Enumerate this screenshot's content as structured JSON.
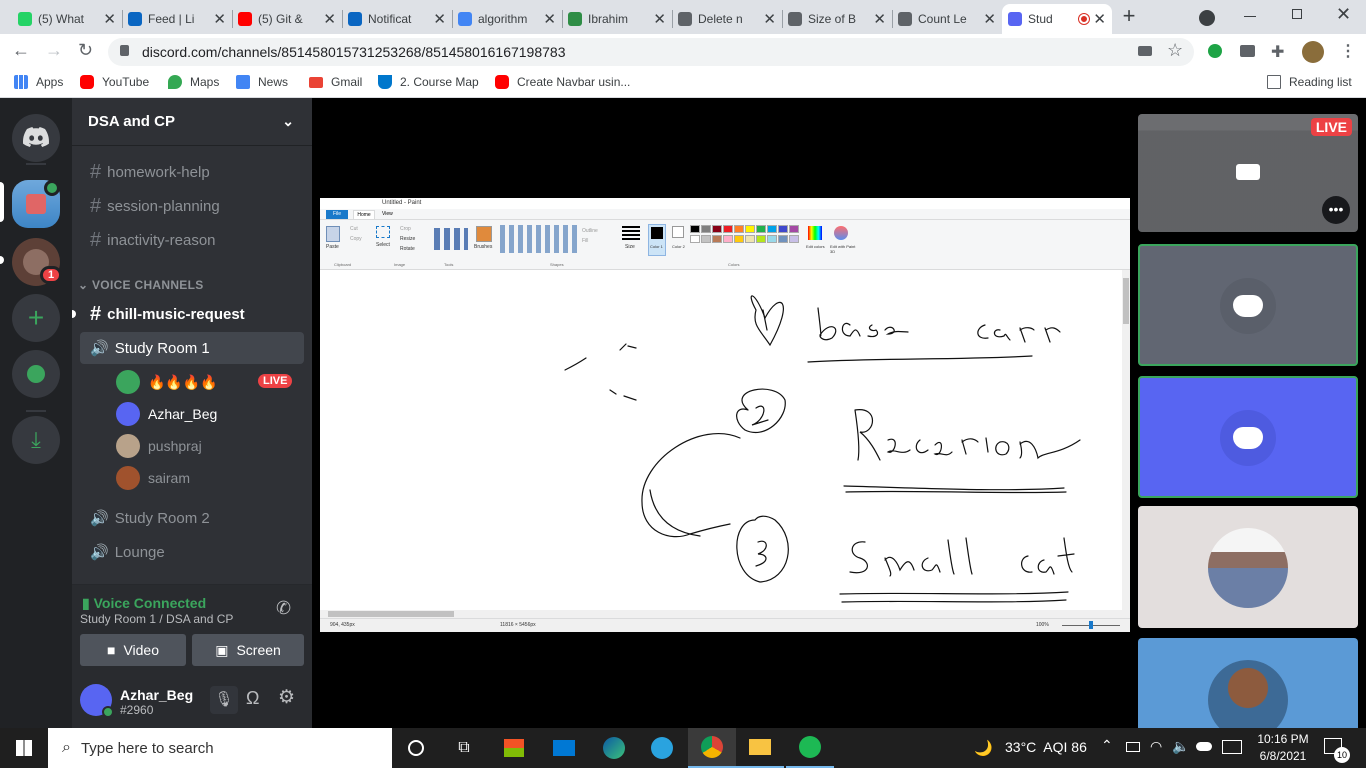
{
  "browser": {
    "tabs": [
      {
        "label": "(5) What",
        "fav": "whatsapp-icon",
        "color": "#25d366"
      },
      {
        "label": "Feed | Li",
        "fav": "linkedin-icon",
        "color": "#0a66c2"
      },
      {
        "label": "(5) Git &",
        "fav": "youtube-icon",
        "color": "#ff0000"
      },
      {
        "label": "Notificat",
        "fav": "linkedin-icon",
        "color": "#0a66c2"
      },
      {
        "label": "algorithm",
        "fav": "google-icon",
        "color": "#4285f4"
      },
      {
        "label": "Ibrahim",
        "fav": "gfg-icon",
        "color": "#2f8d46"
      },
      {
        "label": "Delete n",
        "fav": "globe-icon",
        "color": "#5f6368"
      },
      {
        "label": "Size of B",
        "fav": "globe-icon",
        "color": "#5f6368"
      },
      {
        "label": "Count Le",
        "fav": "globe-icon",
        "color": "#5f6368"
      },
      {
        "label": "Stud",
        "fav": "discord-icon",
        "color": "#5865f2"
      }
    ],
    "url": "discord.com/channels/851458015731253268/851458016167198783",
    "bookmarks": [
      "Apps",
      "YouTube",
      "Maps",
      "News",
      "Gmail",
      "2. Course Map",
      "Create Navbar usin..."
    ],
    "reading_list": "Reading list"
  },
  "discord": {
    "server_name": "DSA and CP",
    "text_channels": [
      "homework-help",
      "session-planning",
      "inactivity-reason"
    ],
    "voice_header": "VOICE CHANNELS",
    "chill": "chill-music-request",
    "study_room_1": "Study Room 1",
    "voice_users": [
      {
        "name": "🔥🔥🔥🔥",
        "color": "#3ba55d"
      },
      {
        "name": "Azhar_Beg",
        "color": "#5865f2"
      },
      {
        "name": "pushpraj",
        "color": "#b8a28a"
      },
      {
        "name": "sairam",
        "color": "#a0522d"
      }
    ],
    "live_badge": "LIVE",
    "study_room_2": "Study Room 2",
    "lounge": "Lounge",
    "voice_status": "Voice Connected",
    "voice_location": "Study Room 1 / DSA and CP",
    "video_btn": "Video",
    "screen_btn": "Screen",
    "username": "Azhar_Beg",
    "discriminator": "#2960",
    "notif_count": "1",
    "tile_live": "LIVE"
  },
  "paint": {
    "title": "Untitled - Paint",
    "file_tab": "File",
    "home_tab": "Home",
    "view_tab": "View",
    "groups": [
      "Clipboard",
      "Image",
      "Tools",
      "Shapes",
      "Colors"
    ],
    "labels": [
      "Paste",
      "Cut",
      "Copy",
      "Select",
      "Crop",
      "Resize",
      "Rotate",
      "Brushes",
      "Outline",
      "Fill",
      "Size",
      "Color 1",
      "Color 2",
      "Edit colors",
      "Edit with Paint 3D"
    ],
    "status_pos": "904, 435px",
    "status_size": "11816 × 5456px",
    "zoom": "100%",
    "palette": [
      "#000000",
      "#7f7f7f",
      "#880015",
      "#ed1c24",
      "#ff7f27",
      "#fff200",
      "#22b14c",
      "#00a2e8",
      "#3f48cc",
      "#a349a4",
      "#ffffff",
      "#c3c3c3",
      "#b97a57",
      "#ffaec9",
      "#ffc90e",
      "#efe4b0",
      "#b5e61d",
      "#99d9ea",
      "#7092be",
      "#c8bfe7"
    ]
  },
  "taskbar": {
    "search": "Type here to search",
    "weather": "33°C  AQI 86",
    "time": "10:16 PM",
    "date": "6/8/2021",
    "notif": "10"
  }
}
